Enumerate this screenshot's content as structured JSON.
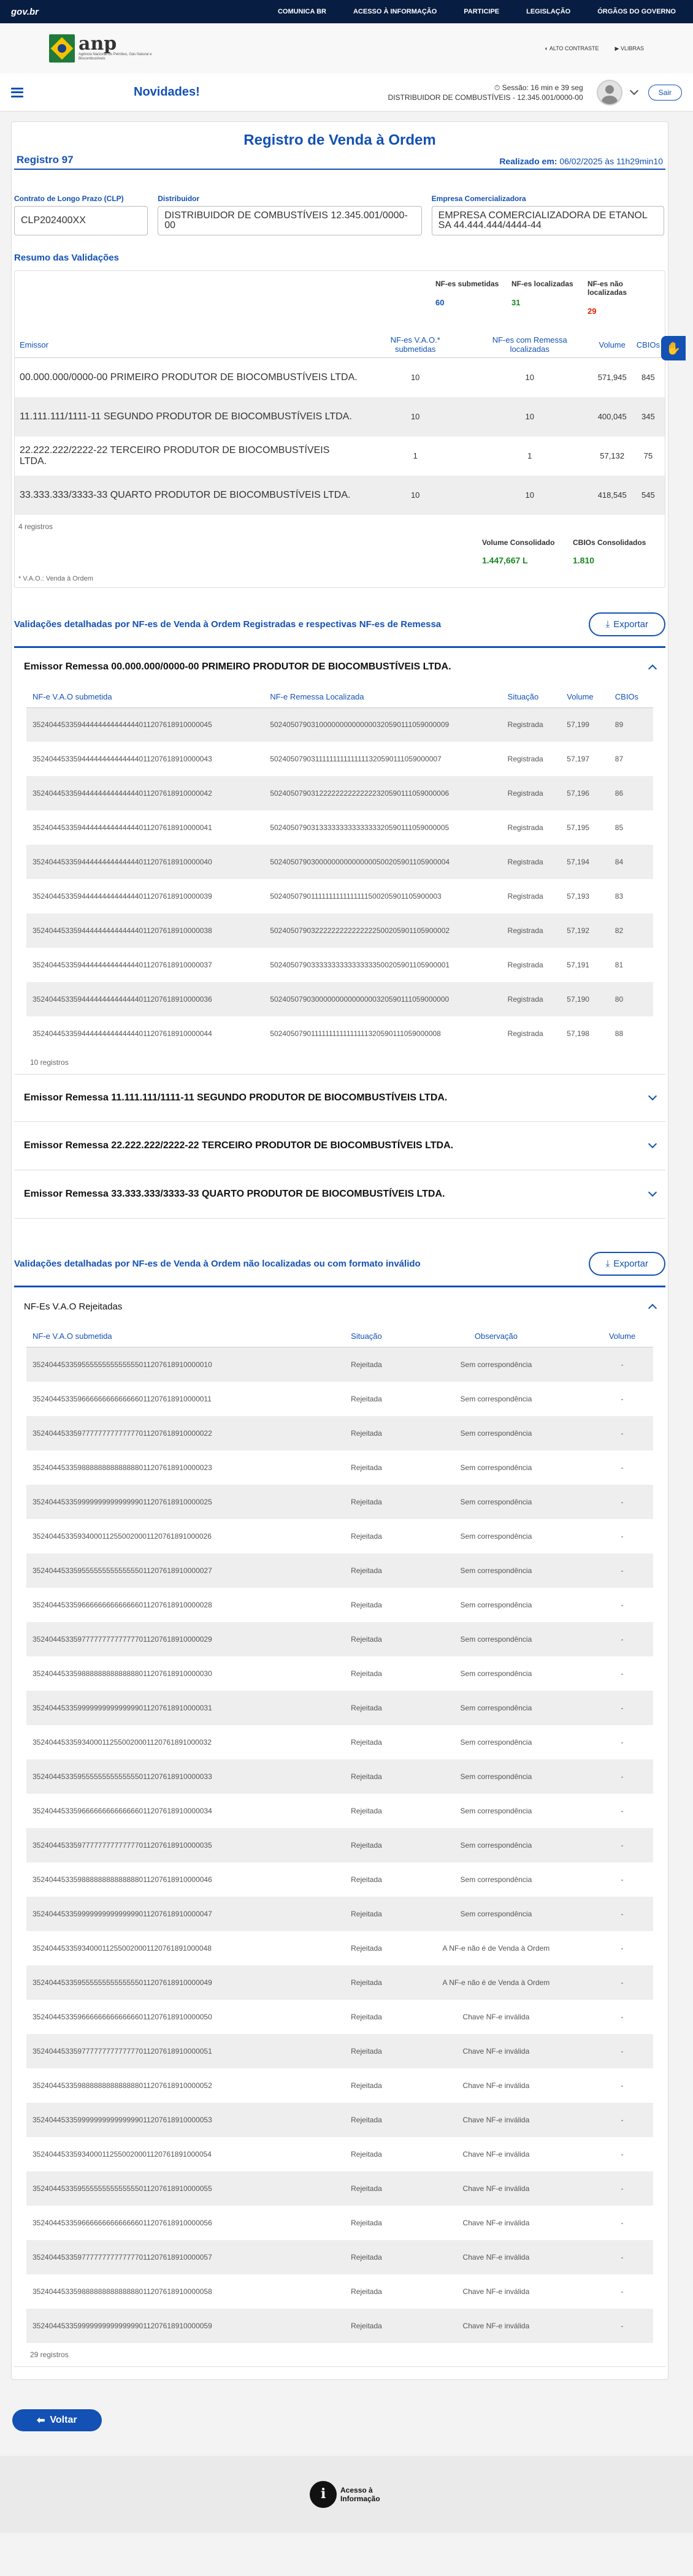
{
  "topbar": {
    "brand": "gov.br",
    "links": [
      "COMUNICA BR",
      "ACESSO À INFORMAÇÃO",
      "PARTICIPE",
      "LEGISLAÇÃO",
      "ÓRGÃOS DO GOVERNO"
    ]
  },
  "header": {
    "logo_text": "anp",
    "logo_sub": "Agência Nacional do Petróleo, Gás Natural e Biocombustíveis",
    "alto_contraste": "ALTO CONTRASTE",
    "vlibras": "VLIBRAS",
    "page_title": "Novidades!",
    "session": "Sessão: 16 min e 39 seg",
    "user": "DISTRIBUIDOR DE COMBUSTÍVEIS - 12.345.001/0000-00",
    "sair": "Sair"
  },
  "page": {
    "title": "Registro de Venda à Ordem",
    "registro": "Registro 97",
    "realizado_label": "Realizado em:",
    "realizado_value": "06/02/2025 às 11h29min10"
  },
  "fields": {
    "clp_label": "Contrato de Longo Prazo (CLP)",
    "clp_value": "CLP202400XX",
    "dist_label": "Distribuidor",
    "dist_value": "DISTRIBUIDOR DE COMBUSTÍVEIS 12.345.001/0000-00",
    "emp_label": "Empresa Comercializadora",
    "emp_value": "EMPRESA COMERCIALIZADORA DE ETANOL SA 44.444.444/4444-44"
  },
  "resumo": {
    "title": "Resumo das Validações",
    "totals": [
      {
        "label": "NF-es submetidas",
        "value": "60",
        "color": "#1351b4"
      },
      {
        "label": "NF-es localizadas",
        "value": "31",
        "color": "#168821"
      },
      {
        "label": "NF-es não localizadas",
        "value": "29",
        "color": "#e52207"
      }
    ],
    "headers": [
      "Emissor",
      "NF-es V.A.O.* submetidas",
      "NF-es com Remessa localizadas",
      "Volume",
      "CBIOs"
    ],
    "rows": [
      [
        "00.000.000/0000-00 PRIMEIRO PRODUTOR DE BIOCOMBUSTÍVEIS LTDA.",
        "10",
        "10",
        "571,945",
        "845"
      ],
      [
        "11.111.111/1111-11 SEGUNDO PRODUTOR DE BIOCOMBUSTÍVEIS LTDA.",
        "10",
        "10",
        "400,045",
        "345"
      ],
      [
        "22.222.222/2222-22 TERCEIRO PRODUTOR DE BIOCOMBUSTÍVEIS LTDA.",
        "1",
        "1",
        "57,132",
        "75"
      ],
      [
        "33.333.333/3333-33 QUARTO PRODUTOR DE BIOCOMBUSTÍVEIS LTDA.",
        "10",
        "10",
        "418,545",
        "545"
      ]
    ],
    "count": "4 registros",
    "vol_label": "Volume Consolidado",
    "vol_value": "1.447,667 L",
    "cbio_label": "CBIOs Consolidados",
    "cbio_value": "1.810",
    "note": "* V.A.O.: Venda à Ordem"
  },
  "detalhadas": {
    "title": "Validações detalhadas por NF-es de Venda à Ordem Registradas e respectivas NF-es de Remessa",
    "export": "Exportar",
    "emissor1": "Emissor Remessa 00.000.000/0000-00 PRIMEIRO PRODUTOR DE BIOCOMBUSTÍVEIS LTDA.",
    "headers": [
      "NF-e V.A.O submetida",
      "NF-e Remessa Localizada",
      "Situação",
      "Volume",
      "CBIOs"
    ],
    "rows": [
      [
        "35240445335944444444444444011207618910000045",
        "50240507903100000000000000320590111059000009",
        "Registrada",
        "57,199",
        "89"
      ],
      [
        "35240445335944444444444444011207618910000043",
        "50240507903111111111111111320590111059000007",
        "Registrada",
        "57,197",
        "87"
      ],
      [
        "35240445335944444444444444011207618910000042",
        "50240507903122222222222222320590111059000006",
        "Registrada",
        "57,196",
        "86"
      ],
      [
        "35240445335944444444444444011207618910000041",
        "50240507903133333333333333320590111059000005",
        "Registrada",
        "57,195",
        "85"
      ],
      [
        "35240445335944444444444444011207618910000040",
        "50240507903000000000000000500205901105900004",
        "Registrada",
        "57,194",
        "84"
      ],
      [
        "35240445335944444444444444011207618910000039",
        "50240507901111111111111111500205901105900003",
        "Registrada",
        "57,193",
        "83"
      ],
      [
        "35240445335944444444444444011207618910000038",
        "50240507903222222222222222500205901105900002",
        "Registrada",
        "57,192",
        "82"
      ],
      [
        "35240445335944444444444444011207618910000037",
        "50240507903333333333333333500205901105900001",
        "Registrada",
        "57,191",
        "81"
      ],
      [
        "35240445335944444444444444011207618910000036",
        "50240507903000000000000000320590111059000000",
        "Registrada",
        "57,190",
        "80"
      ],
      [
        "35240445335944444444444444011207618910000044",
        "50240507901111111111111111320590111059000008",
        "Registrada",
        "57,198",
        "88"
      ]
    ],
    "count": "10 registros",
    "emissor2": "Emissor Remessa 11.111.111/1111-11 SEGUNDO PRODUTOR DE BIOCOMBUSTÍVEIS LTDA.",
    "emissor3": "Emissor Remessa 22.222.222/2222-22 TERCEIRO PRODUTOR DE BIOCOMBUSTÍVEIS LTDA.",
    "emissor4": "Emissor Remessa 33.333.333/3333-33 QUARTO PRODUTOR DE BIOCOMBUSTÍVEIS LTDA."
  },
  "rejeitadas": {
    "title": "Validações detalhadas por NF-es de Venda à Ordem não localizadas ou com formato inválido",
    "export": "Exportar",
    "acc_title": "NF-Es V.A.O Rejeitadas",
    "headers": [
      "NF-e V.A.O submetida",
      "Situação",
      "Observação",
      "Volume"
    ],
    "rows": [
      [
        "35240445335955555555555555011207618910000010",
        "Rejeitada",
        "Sem correspondência",
        "-"
      ],
      [
        "35240445335966666666666666011207618910000011",
        "Rejeitada",
        "Sem correspondência",
        "-"
      ],
      [
        "35240445335977777777777777011207618910000022",
        "Rejeitada",
        "Sem correspondência",
        "-"
      ],
      [
        "35240445335988888888888888011207618910000023",
        "Rejeitada",
        "Sem correspondência",
        "-"
      ],
      [
        "35240445335999999999999999011207618910000025",
        "Rejeitada",
        "Sem correspondência",
        "-"
      ],
      [
        "35240445335934000112550020001120761891000026",
        "Rejeitada",
        "Sem correspondência",
        "-"
      ],
      [
        "35240445335955555555555555011207618910000027",
        "Rejeitada",
        "Sem correspondência",
        "-"
      ],
      [
        "35240445335966666666666666011207618910000028",
        "Rejeitada",
        "Sem correspondência",
        "-"
      ],
      [
        "35240445335977777777777777011207618910000029",
        "Rejeitada",
        "Sem correspondência",
        "-"
      ],
      [
        "35240445335988888888888888011207618910000030",
        "Rejeitada",
        "Sem correspondência",
        "-"
      ],
      [
        "35240445335999999999999999011207618910000031",
        "Rejeitada",
        "Sem correspondência",
        "-"
      ],
      [
        "35240445335934000112550020001120761891000032",
        "Rejeitada",
        "Sem correspondência",
        "-"
      ],
      [
        "35240445335955555555555555011207618910000033",
        "Rejeitada",
        "Sem correspondência",
        "-"
      ],
      [
        "35240445335966666666666666011207618910000034",
        "Rejeitada",
        "Sem correspondência",
        "-"
      ],
      [
        "35240445335977777777777777011207618910000035",
        "Rejeitada",
        "Sem correspondência",
        "-"
      ],
      [
        "35240445335988888888888888011207618910000046",
        "Rejeitada",
        "Sem correspondência",
        "-"
      ],
      [
        "35240445335999999999999999011207618910000047",
        "Rejeitada",
        "Sem correspondência",
        "-"
      ],
      [
        "35240445335934000112550020001120761891000048",
        "Rejeitada",
        "A NF-e não é de Venda à Ordem",
        "-"
      ],
      [
        "35240445335955555555555555011207618910000049",
        "Rejeitada",
        "A NF-e não é de Venda à Ordem",
        "-"
      ],
      [
        "35240445335966666666666666011207618910000050",
        "Rejeitada",
        "Chave NF-e inválida",
        "-"
      ],
      [
        "35240445335977777777777777011207618910000051",
        "Rejeitada",
        "Chave NF-e inválida",
        "-"
      ],
      [
        "35240445335988888888888888011207618910000052",
        "Rejeitada",
        "Chave NF-e inválida",
        "-"
      ],
      [
        "35240445335999999999999999011207618910000053",
        "Rejeitada",
        "Chave NF-e inválida",
        "-"
      ],
      [
        "35240445335934000112550020001120761891000054",
        "Rejeitada",
        "Chave NF-e inválida",
        "-"
      ],
      [
        "35240445335955555555555555011207618910000055",
        "Rejeitada",
        "Chave NF-e inválida",
        "-"
      ],
      [
        "35240445335966666666666666011207618910000056",
        "Rejeitada",
        "Chave NF-e inválida",
        "-"
      ],
      [
        "35240445335977777777777777011207618910000057",
        "Rejeitada",
        "Chave NF-e inválida",
        "-"
      ],
      [
        "35240445335988888888888888011207618910000058",
        "Rejeitada",
        "Chave NF-e inválida",
        "-"
      ],
      [
        "35240445335999999999999999011207618910000059",
        "Rejeitada",
        "Chave NF-e inválida",
        "-"
      ]
    ],
    "count": "29 registros"
  },
  "voltar": "Voltar",
  "footer": {
    "text": "Acesso à Informação"
  }
}
